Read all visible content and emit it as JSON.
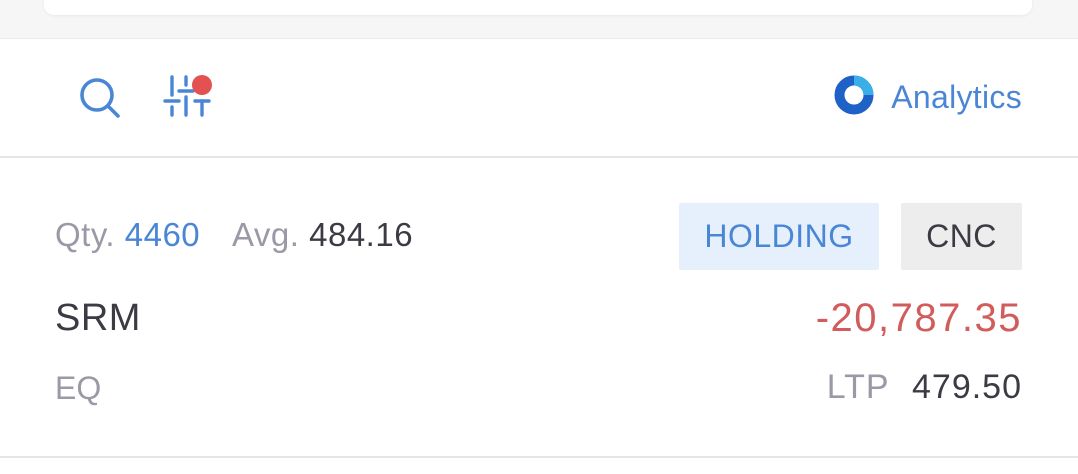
{
  "toolbar": {
    "analytics_label": "Analytics",
    "accent_color": "#4a86d6",
    "filter_indicator_color": "#e45151",
    "icons": [
      "search-icon",
      "filter-sliders-icon",
      "analytics-donut-icon"
    ]
  },
  "position": {
    "qty_label": "Qty.",
    "qty_value": "4460",
    "avg_label": "Avg.",
    "avg_value": "484.16",
    "badges": [
      {
        "label": "HOLDING",
        "color": "#4a86d6",
        "background": "#e5f0fc"
      },
      {
        "label": "CNC",
        "color": "#3b3b44",
        "background": "#ededed"
      }
    ],
    "symbol": "SRM",
    "pnl": "-20,787.35",
    "pnl_color": "#d25c5c",
    "exchange": "EQ",
    "ltp_label": "LTP",
    "ltp_value": "479.50"
  }
}
